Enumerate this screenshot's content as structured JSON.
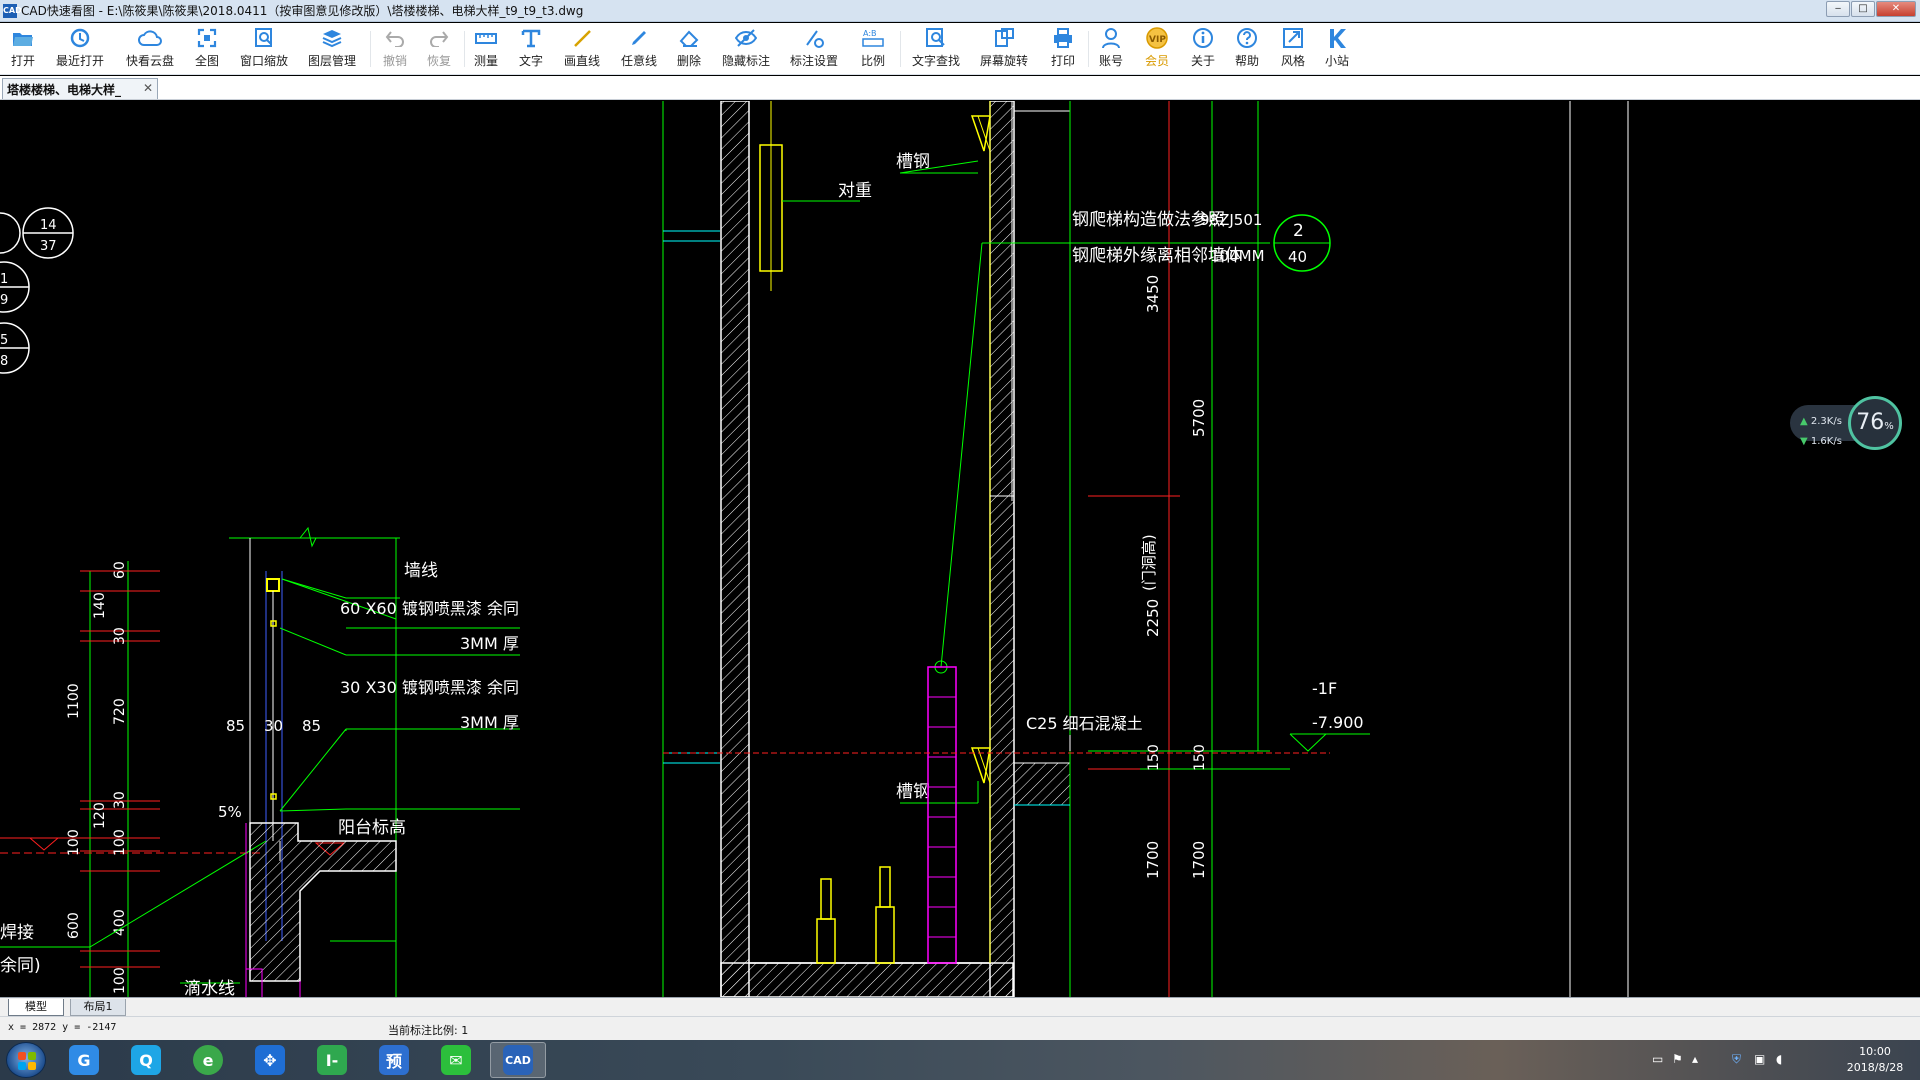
{
  "window": {
    "app_icon_text": "CAD",
    "title": "CAD快速看图 - E:\\陈筱果\\陈筱果\\2018.0411（按审图意见修改版）\\塔楼楼梯、电梯大样_t9_t9_t3.dwg",
    "minimize": "‒",
    "maximize": "□",
    "close": "✕"
  },
  "toolbar": {
    "items": [
      {
        "label": "打开",
        "icon": "folder-open-icon"
      },
      {
        "label": "最近打开",
        "icon": "recent-clock-icon"
      },
      {
        "label": "快看云盘",
        "icon": "cloud-icon"
      },
      {
        "label": "全图",
        "icon": "fullview-icon"
      },
      {
        "label": "窗口缩放",
        "icon": "window-zoom-icon"
      },
      {
        "label": "图层管理",
        "icon": "layers-icon"
      },
      {
        "label": "撤销",
        "icon": "undo-icon"
      },
      {
        "label": "恢复",
        "icon": "redo-icon"
      },
      {
        "label": "测量",
        "icon": "measure-icon"
      },
      {
        "label": "文字",
        "icon": "text-icon"
      },
      {
        "label": "画直线",
        "icon": "line-icon"
      },
      {
        "label": "任意线",
        "icon": "freehand-icon"
      },
      {
        "label": "删除",
        "icon": "eraser-icon"
      },
      {
        "label": "隐藏标注",
        "icon": "eye-hide-icon"
      },
      {
        "label": "标注设置",
        "icon": "annotation-settings-icon"
      },
      {
        "label": "比例",
        "icon": "scale-icon"
      },
      {
        "label": "文字查找",
        "icon": "text-search-icon"
      },
      {
        "label": "屏幕旋转",
        "icon": "rotate-screen-icon"
      },
      {
        "label": "打印",
        "icon": "printer-icon"
      },
      {
        "label": "账号",
        "icon": "user-icon"
      },
      {
        "label": "会员",
        "icon": "vip-icon"
      },
      {
        "label": "关于",
        "icon": "info-icon"
      },
      {
        "label": "帮助",
        "icon": "help-icon"
      },
      {
        "label": "风格",
        "icon": "style-icon"
      },
      {
        "label": "小站",
        "icon": "k-station-icon"
      }
    ]
  },
  "doc_tab": {
    "label": "塔楼楼梯、电梯大样_",
    "close": "✕"
  },
  "drawing": {
    "circle_labels": [
      {
        "top": "14",
        "bottom": "37"
      },
      {
        "top": "1",
        "bottom": "9"
      },
      {
        "top": "5",
        "bottom": "8"
      },
      {
        "top": "2",
        "bottom": "40"
      }
    ],
    "texts": {
      "counterweight": "对重",
      "channel_steel_top": "槽钢",
      "channel_steel_bottom": "槽钢",
      "ladder_note_1": "钢爬梯构造做法参照",
      "ladder_note_1_ref": "98ZJ501",
      "ladder_note_2": "钢爬梯外缘离相邻墙体",
      "ladder_note_2_dim": "100MM",
      "wall_line": "墙线",
      "steel_60": "60 X60 镀钢喷黑漆 余同",
      "thick_3mm_a": "3MM 厚",
      "steel_30": "30 X30 镀钢喷黑漆 余同",
      "thick_3mm_b": "3MM 厚",
      "slope": "5%",
      "balcony_level": "阳台标高",
      "drip_line": "滴水线",
      "weld": "焊接",
      "same": "余同)",
      "concrete": "C25 细石混凝土",
      "floor": "-1F",
      "elevation": "-7.900",
      "door_height": "(门洞高)"
    },
    "dims_left": [
      "60",
      "140",
      "30",
      "720",
      "30",
      "120",
      "100",
      "100",
      "400",
      "100"
    ],
    "dim_left_total": "1100",
    "dim_left_600": "600",
    "dims_rail": [
      "85",
      "30",
      "85"
    ],
    "dims_right": [
      "3450",
      "5700",
      "2250",
      "150",
      "150",
      "1700",
      "1700"
    ]
  },
  "net_widget": {
    "up": "2.3K/s",
    "down": "1.6K/s",
    "percent": "76",
    "percent_unit": "%"
  },
  "layout_tabs": {
    "model": "模型",
    "layout1": "布局1"
  },
  "status": {
    "coords": "x = 2872  y = -2147",
    "scale": "当前标注比例: 1"
  },
  "taskbar": {
    "apps": [
      {
        "name": "chrome",
        "text": "G",
        "color": "#2f8be6"
      },
      {
        "name": "qq-browser",
        "text": "Q",
        "color": "#1ea6e6"
      },
      {
        "name": "360-browser",
        "text": "e",
        "color": "#3aa84a"
      },
      {
        "name": "teamviewer",
        "text": "✥",
        "color": "#1f6ed4"
      },
      {
        "name": "green-app",
        "text": "I-",
        "color": "#2fa84f"
      },
      {
        "name": "preview",
        "text": "预",
        "color": "#2d6fd0"
      },
      {
        "name": "wechat",
        "text": "✉",
        "color": "#2cbf3c"
      },
      {
        "name": "cad-viewer",
        "text": "CAD",
        "color": "#2a63b8"
      }
    ],
    "clock_time": "10:00",
    "clock_date": "2018/8/28"
  },
  "colors": {
    "wall_white": "#ffffff",
    "green": "#00ff00",
    "red": "#ff2020",
    "yellow": "#ffff00",
    "magenta": "#ff00ff",
    "cyan": "#00ffff"
  }
}
